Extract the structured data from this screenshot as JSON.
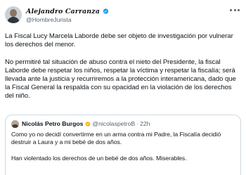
{
  "author": {
    "name": "Alejandro Carranza",
    "handle": "@HombreJurista",
    "verified_color": "#1d9bf0"
  },
  "tweet": {
    "paragraphs": [
      "La Fiscal Lucy Marcela Laborde debe ser objeto de investigación por vulnerar los derechos del menor.",
      "No permitiré tal situación de abuso contra el nieto del Presidente, la fiscal Laborde debe respetar los niños, respetar la víctima y respetar la fiscalía; será llevada ante la justicia y recurriremos a la protección interamericana, dado que la Fiscal General la respalda con su opacidad en la violación de los derechos del niño."
    ]
  },
  "quoted_tweet": {
    "name": "Nicolás Petro Burgos",
    "handle": "@nicolaspetroB",
    "separator": "·",
    "time": "22h",
    "verified_color": "#f5b80b",
    "paragraphs": [
      "Como yo no decidí convertirme en un arma contra mi Padre, la Fiscalía decidió destruir a Laura y a mi bebé de dos años.",
      "Han violentado los derechos de un bebé de dos años. Miserables."
    ]
  },
  "icons": {
    "author_avatar": "avatar-photo",
    "author_badge": "verified-badge-icon",
    "menu": "more-options-icon",
    "quoted_avatar": "avatar-photo",
    "quoted_badge": "verified-badge-icon"
  }
}
